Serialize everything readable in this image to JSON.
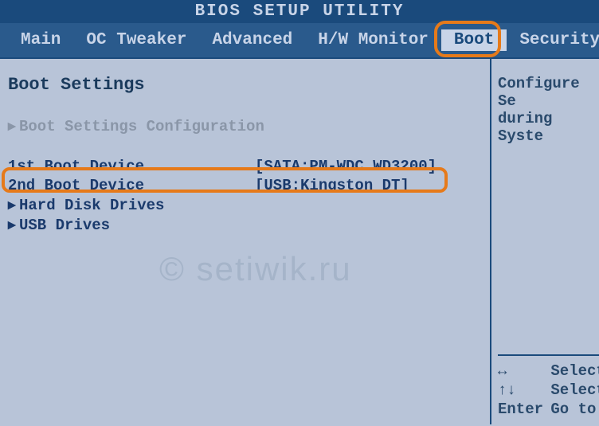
{
  "title": "BIOS SETUP UTILITY",
  "menu": {
    "items": [
      {
        "label": "Main"
      },
      {
        "label": "OC Tweaker"
      },
      {
        "label": "Advanced"
      },
      {
        "label": "H/W Monitor"
      },
      {
        "label": "Boot",
        "active": true
      },
      {
        "label": "Security"
      }
    ]
  },
  "main": {
    "section_title": "Boot Settings",
    "config_line": "Boot Settings Configuration",
    "devices": [
      {
        "label": "1st Boot Device",
        "value": "[SATA:PM-WDC WD3200]"
      },
      {
        "label": "2nd Boot Device",
        "value": "[USB:Kingston DT]"
      }
    ],
    "sub_items": [
      "Hard Disk Drives",
      "USB Drives"
    ]
  },
  "side": {
    "help": [
      "Configure Se",
      "during Syste"
    ],
    "keys": [
      {
        "sym": "↔",
        "desc": "Select"
      },
      {
        "sym": "↑↓",
        "desc": "Select"
      },
      {
        "sym": "Enter",
        "desc": "Go to "
      }
    ]
  },
  "watermark": "© setiwik.ru"
}
